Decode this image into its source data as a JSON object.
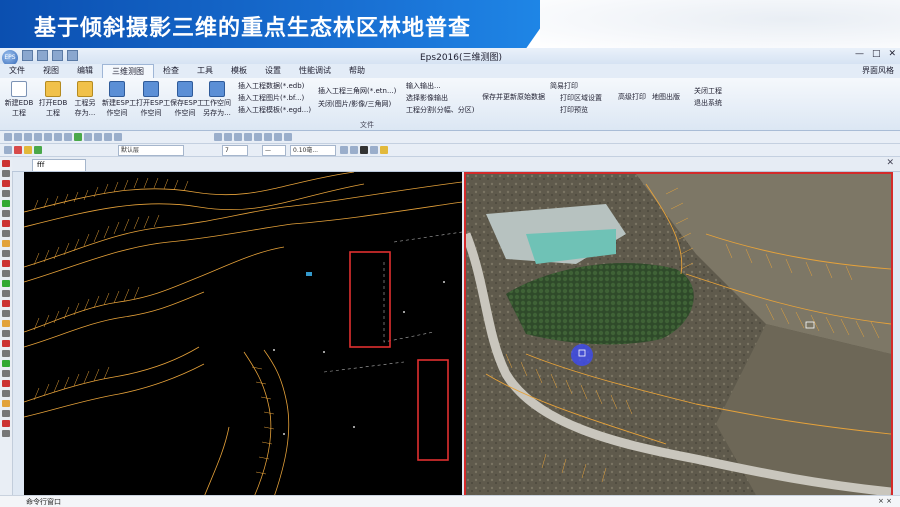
{
  "slide_title": "基于倾斜摄影三维的重点生态林区林地普查",
  "window": {
    "title": "Eps2016(三维测图)",
    "orb_label": "EPS",
    "controls": [
      "—",
      "□",
      "✕"
    ]
  },
  "menu": {
    "items": [
      "文件",
      "视图",
      "编辑",
      "三维测图",
      "检查",
      "工具",
      "模板",
      "设置",
      "性能调试",
      "帮助"
    ],
    "active_index": 3,
    "style_label": "界面风格"
  },
  "ribbon": {
    "buttons": [
      {
        "label1": "新建EDB",
        "label2": "工程"
      },
      {
        "label1": "打开EDB",
        "label2": "工程"
      },
      {
        "label1": "工程另",
        "label2": "存为..."
      },
      {
        "label1": "新建ESP工",
        "label2": "作空间"
      },
      {
        "label1": "打开ESP工",
        "label2": "作空间"
      },
      {
        "label1": "保存ESP工",
        "label2": "作空间"
      },
      {
        "label1": "工作空间",
        "label2": "另存为..."
      }
    ],
    "col1": [
      "插入工程数据(*.edb)",
      "插入工程图片(*.bf...)",
      "插入工程模板(*.egd...)"
    ],
    "col2": [
      "插入工程三角网(*.etn...)",
      "关闭(图片/影像/三角网)"
    ],
    "col3": [
      "输入输出...",
      "选择影像输出",
      "工程分割(分幅、分区)"
    ],
    "col4": [
      "保存并更新原始数据"
    ],
    "col5": [
      "简易打印",
      "打印区域设置",
      "打印预览"
    ],
    "col6": [
      "高级打印"
    ],
    "col7": [
      "地图出版"
    ],
    "col8": [
      "关闭工程",
      "退出系统"
    ],
    "group_label": "文件"
  },
  "toolbar": {
    "layer_combo": "默认层",
    "width_combo": "0.10毫...",
    "num_combo": "7",
    "linestyle_combo": "—"
  },
  "doc_tab": "tab-fff",
  "doc_tab_label": "fff",
  "command": {
    "label": "命令行窗口",
    "close": "× ×"
  },
  "colors": {
    "banner_blue": "#1565c8",
    "cad_background": "#000000",
    "contour_orange": "#e6a23a",
    "boundary_red": "#e03030",
    "viewport_border": "#d42a2a"
  }
}
